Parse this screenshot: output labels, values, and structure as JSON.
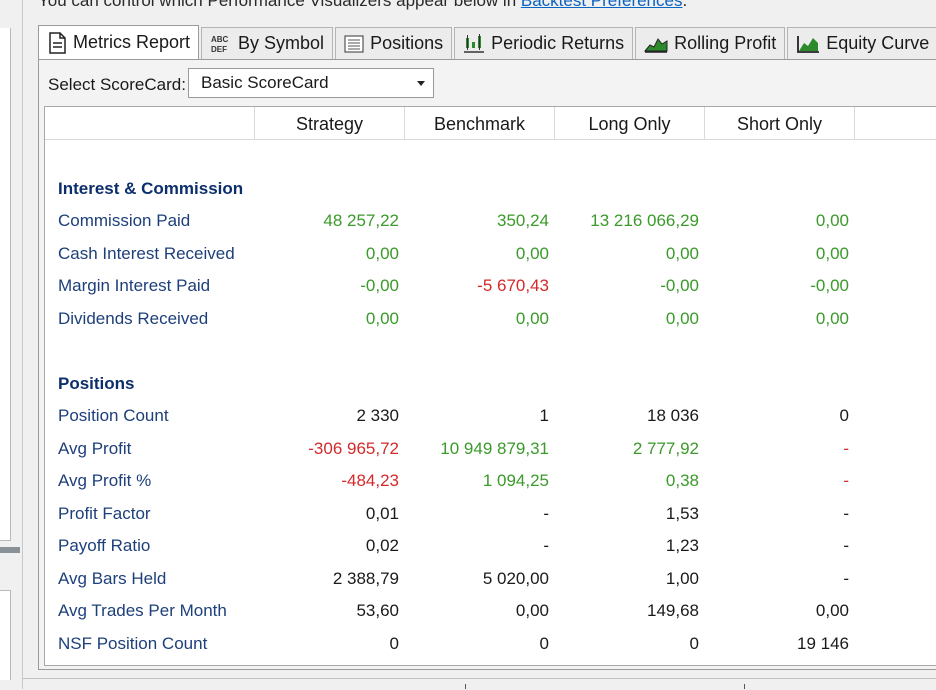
{
  "info": {
    "text": "You can control which Performance Visualizers appear below in ",
    "link": "Backtest Preferences",
    "suffix": "."
  },
  "tabs": [
    {
      "label": "Metrics Report",
      "icon": "document-icon",
      "active": true
    },
    {
      "label": "By Symbol",
      "icon": "abc-def-icon"
    },
    {
      "label": "Positions",
      "icon": "list-icon"
    },
    {
      "label": "Periodic Returns",
      "icon": "candlestick-icon"
    },
    {
      "label": "Rolling Profit",
      "icon": "area-chart-icon"
    },
    {
      "label": "Equity Curve",
      "icon": "equity-chart-icon"
    }
  ],
  "scorecard": {
    "label": "Select ScoreCard:",
    "selected": "Basic ScoreCard"
  },
  "columns": [
    "Strategy",
    "Benchmark",
    "Long Only",
    "Short Only"
  ],
  "sections": [
    {
      "title": "Interest & Commission",
      "rows": [
        {
          "label": "Commission Paid",
          "values": [
            "48 257,22",
            "350,24",
            "13 216 066,29",
            "0,00"
          ]
        },
        {
          "label": "Cash Interest Received",
          "values": [
            "0,00",
            "0,00",
            "0,00",
            "0,00"
          ]
        },
        {
          "label": "Margin Interest Paid",
          "values": [
            "-0,00",
            "-5 670,43",
            "-0,00",
            "-0,00"
          ]
        },
        {
          "label": "Dividends Received",
          "values": [
            "0,00",
            "0,00",
            "0,00",
            "0,00"
          ]
        }
      ]
    },
    {
      "title": "Positions",
      "rows": [
        {
          "label": "Position Count",
          "values": [
            "2 330",
            "1",
            "18 036",
            "0"
          ]
        },
        {
          "label": "Avg Profit",
          "values": [
            "-306 965,72",
            "10 949 879,31",
            "2 777,92",
            "-"
          ]
        },
        {
          "label": "Avg Profit %",
          "values": [
            "-484,23",
            "1 094,25",
            "0,38",
            "-"
          ]
        },
        {
          "label": "Profit Factor",
          "values": [
            "0,01",
            "-",
            "1,53",
            "-"
          ]
        },
        {
          "label": "Payoff Ratio",
          "values": [
            "0,02",
            "-",
            "1,23",
            "-"
          ]
        },
        {
          "label": "Avg Bars Held",
          "values": [
            "2 388,79",
            "5 020,00",
            "1,00",
            "-"
          ]
        },
        {
          "label": "Avg Trades Per Month",
          "values": [
            "53,60",
            "0,00",
            "149,68",
            "0,00"
          ]
        },
        {
          "label": "NSF Position Count",
          "values": [
            "0",
            "0",
            "0",
            "19 146"
          ]
        }
      ]
    }
  ],
  "colors": {
    "positive": "#3a9a2a",
    "negative": "#d42a2a",
    "neutral": "#1a1a1a",
    "label": "#1d3f7a",
    "section": "#0c2f6b"
  }
}
